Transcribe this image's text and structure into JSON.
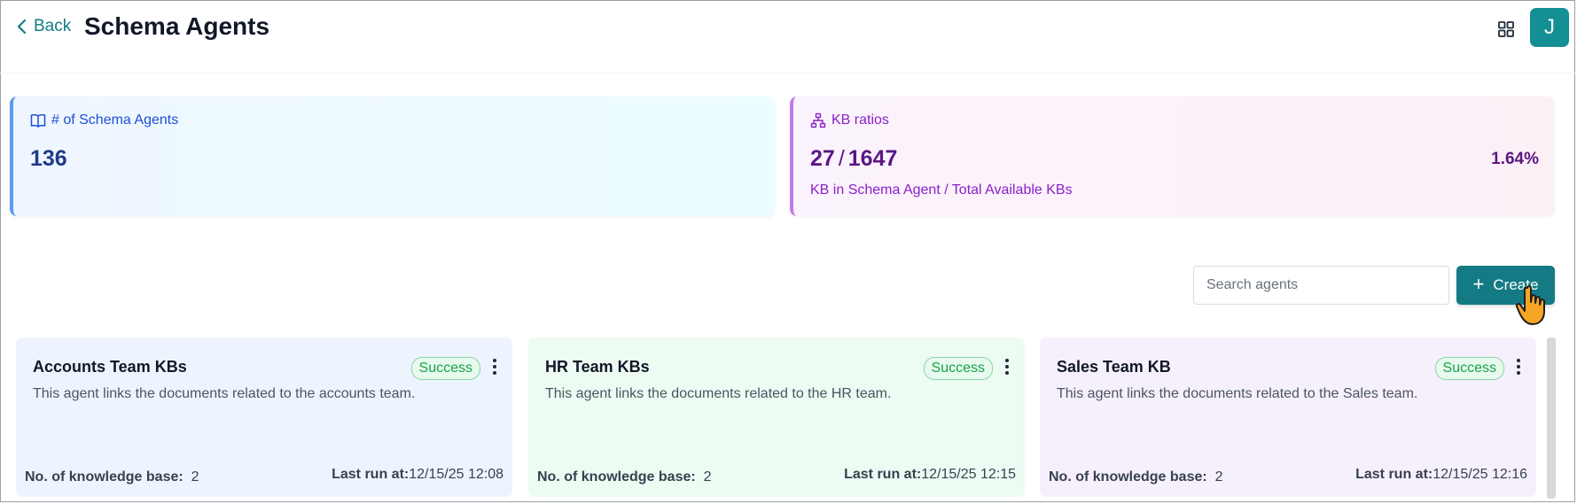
{
  "header": {
    "back_label": "Back",
    "title": "Schema Agents",
    "avatar_initial": "J"
  },
  "stats": {
    "agents": {
      "label": "# of Schema Agents",
      "value": "136"
    },
    "kb": {
      "label": "KB ratios",
      "numerator": "27",
      "separator": "/",
      "denominator": "1647",
      "percent": "1.64%",
      "sub_label": "KB in Schema Agent / Total Available KBs"
    }
  },
  "actions": {
    "search_placeholder": "Search agents",
    "create_label": "Create"
  },
  "cards": [
    {
      "title": "Accounts Team KBs",
      "status": "Success",
      "description": "This agent links the documents related to the accounts team.",
      "kb_label": "No. of knowledge base:",
      "kb_count": "2",
      "last_run_label": "Last run at:",
      "last_run": "12/15/25 12:08"
    },
    {
      "title": "HR Team KBs",
      "status": "Success",
      "description": "This agent links the documents related to the HR team.",
      "kb_label": "No. of knowledge base:",
      "kb_count": "2",
      "last_run_label": "Last run at:",
      "last_run": "12/15/25 12:15"
    },
    {
      "title": "Sales Team KB",
      "status": "Success",
      "description": "This agent links the documents related to the Sales team.",
      "kb_label": "No. of knowledge base:",
      "kb_count": "2",
      "last_run_label": "Last run at:",
      "last_run": "12/15/25 12:16"
    }
  ],
  "colors": {
    "accent": "#147b84",
    "success": "#16a34a",
    "agents_accent": "#5b9cf0",
    "kb_accent": "#c07be6"
  },
  "icons": {
    "back": "chevron-left-icon",
    "apps": "grid-icon",
    "agents": "book-open-icon",
    "kb": "hierarchy-icon",
    "create": "plus-icon",
    "more": "kebab-icon"
  }
}
